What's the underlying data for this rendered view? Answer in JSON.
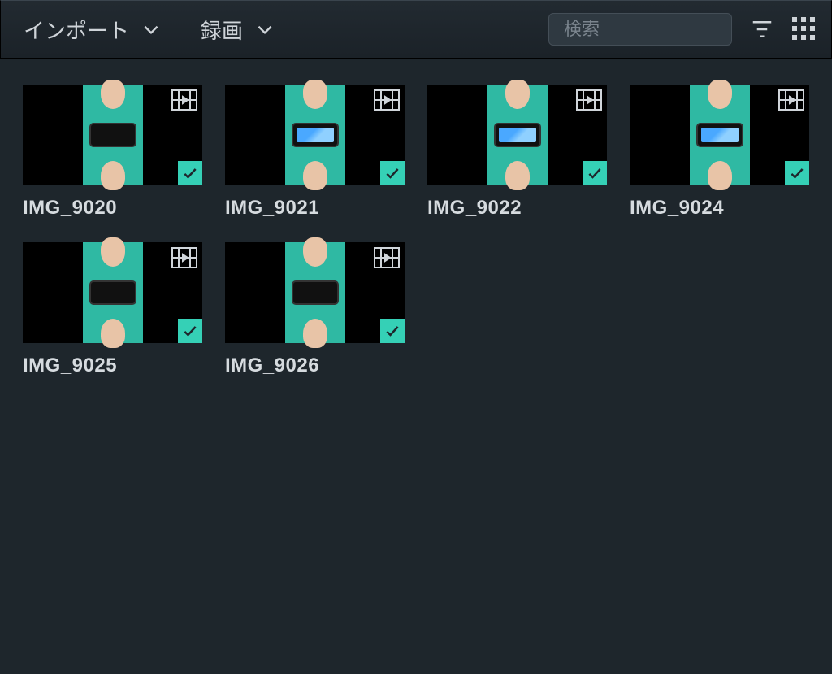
{
  "toolbar": {
    "import_label": "インポート",
    "record_label": "録画"
  },
  "search": {
    "placeholder": "検索",
    "value": ""
  },
  "gallery": {
    "items": [
      {
        "label": "IMG_9020",
        "checked": true,
        "screen_lit": false
      },
      {
        "label": "IMG_9021",
        "checked": true,
        "screen_lit": true
      },
      {
        "label": "IMG_9022",
        "checked": true,
        "screen_lit": true
      },
      {
        "label": "IMG_9024",
        "checked": true,
        "screen_lit": true
      },
      {
        "label": "IMG_9025",
        "checked": true,
        "screen_lit": false
      },
      {
        "label": "IMG_9026",
        "checked": true,
        "screen_lit": false
      }
    ]
  }
}
